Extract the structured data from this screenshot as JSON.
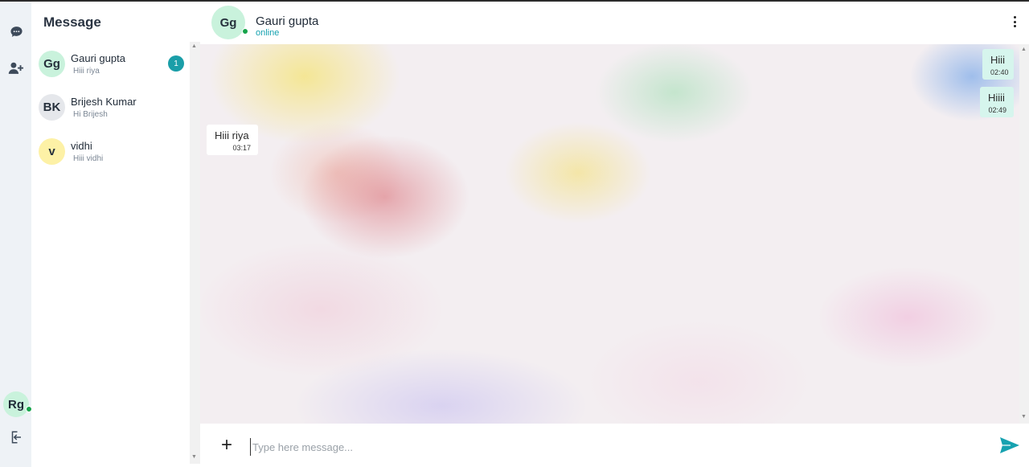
{
  "sidebar": {
    "title": "Message",
    "contacts": [
      {
        "initials": "Gg",
        "name": "Gauri gupta",
        "preview": "Hiii riya",
        "unread": "1",
        "avatar_color": "#c9f2dc"
      },
      {
        "initials": "BK",
        "name": "Brijesh Kumar",
        "preview": "Hi Brijesh",
        "avatar_color": "#e5e7eb"
      },
      {
        "initials": "v",
        "name": "vidhi",
        "preview": "Hiii vidhi",
        "avatar_color": "#fdf1a6"
      }
    ]
  },
  "rail": {
    "current_user_initials": "Rg",
    "icons": [
      "chat-bubble-icon",
      "add-user-icon",
      "logout-icon"
    ]
  },
  "chat": {
    "contact_initials": "Gg",
    "contact_name": "Gauri gupta",
    "status": "online",
    "messages": [
      {
        "direction": "out",
        "text": "Hiii",
        "time": "02:40"
      },
      {
        "direction": "out",
        "text": "Hiiii",
        "time": "02:49"
      },
      {
        "direction": "in",
        "text": "Hiii riya",
        "time": "03:17"
      }
    ]
  },
  "composer": {
    "placeholder": "Type here message...",
    "value": ""
  },
  "colors": {
    "accent": "#17a2b0",
    "badge": "#1a9ea8",
    "online": "#16a34a",
    "outgoing_bubble": "#d6f5ed"
  }
}
